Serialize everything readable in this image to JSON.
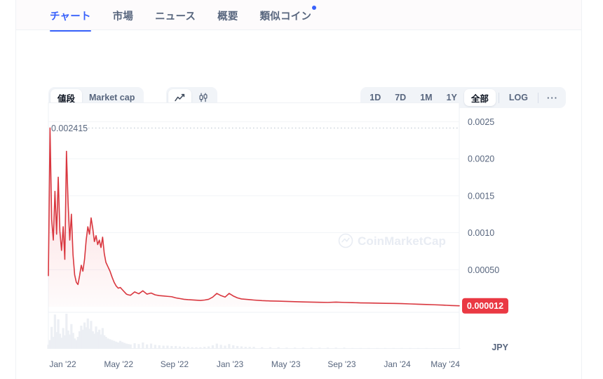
{
  "tabs": [
    {
      "label": "チャート",
      "active": true,
      "dot": false
    },
    {
      "label": "市場",
      "active": false,
      "dot": false
    },
    {
      "label": "ニュース",
      "active": false,
      "dot": false
    },
    {
      "label": "概要",
      "active": false,
      "dot": false
    },
    {
      "label": "類似コイン",
      "active": false,
      "dot": true
    }
  ],
  "toolbar": {
    "metric_price": "値段",
    "metric_marketcap": "Market cap",
    "chart_line_icon": "line-chart-icon",
    "chart_candle_icon": "candlestick-chart-icon",
    "ranges": [
      "1D",
      "7D",
      "1M",
      "1Y",
      "全部"
    ],
    "active_range": "全部",
    "log_label": "LOG",
    "more_label": "···"
  },
  "chart_data": {
    "type": "area",
    "title": "",
    "xlabel": "",
    "ylabel": "",
    "currency": "JPY",
    "watermark": "CoinMarketCap",
    "ylim": [
      0,
      0.00275
    ],
    "yticks": [
      0.0005,
      0.001,
      0.0015,
      0.002,
      0.0025
    ],
    "ytick_labels": [
      "0.00050",
      "0.0010",
      "0.0015",
      "0.0020",
      "0.0025"
    ],
    "grid": true,
    "legend": "none",
    "ath_value": 0.002415,
    "ath_label": "0.002415",
    "current_value": 1.2e-05,
    "current_label": "0.000012",
    "line_color": "#d9373f",
    "fill_top_color": "rgba(234,57,67,0.22)",
    "fill_bottom_color": "rgba(234,57,67,0.02)",
    "badge_color": "#ea3943",
    "xticks": [
      "Jan '22",
      "May '22",
      "Sep '22",
      "Jan '23",
      "May '23",
      "Sep '23",
      "Jan '24",
      "May '24"
    ],
    "xtick_positions": [
      0.035,
      0.171,
      0.307,
      0.442,
      0.578,
      0.714,
      0.849,
      0.966
    ],
    "x": [
      0.0,
      0.004,
      0.008,
      0.012,
      0.016,
      0.02,
      0.024,
      0.028,
      0.032,
      0.036,
      0.04,
      0.044,
      0.048,
      0.052,
      0.056,
      0.06,
      0.064,
      0.068,
      0.072,
      0.076,
      0.08,
      0.084,
      0.088,
      0.092,
      0.096,
      0.1,
      0.104,
      0.108,
      0.112,
      0.116,
      0.12,
      0.124,
      0.128,
      0.132,
      0.136,
      0.14,
      0.145,
      0.15,
      0.155,
      0.16,
      0.165,
      0.17,
      0.175,
      0.18,
      0.185,
      0.19,
      0.195,
      0.2,
      0.21,
      0.22,
      0.23,
      0.24,
      0.25,
      0.26,
      0.27,
      0.28,
      0.29,
      0.3,
      0.31,
      0.32,
      0.33,
      0.34,
      0.35,
      0.36,
      0.37,
      0.38,
      0.39,
      0.4,
      0.41,
      0.42,
      0.43,
      0.44,
      0.45,
      0.46,
      0.47,
      0.48,
      0.49,
      0.5,
      0.52,
      0.54,
      0.56,
      0.58,
      0.6,
      0.62,
      0.64,
      0.66,
      0.68,
      0.7,
      0.72,
      0.74,
      0.76,
      0.78,
      0.8,
      0.82,
      0.84,
      0.86,
      0.88,
      0.9,
      0.92,
      0.94,
      0.96,
      0.98,
      1.0
    ],
    "values": [
      0.00042,
      0.002415,
      0.00118,
      0.0009,
      0.00156,
      0.00098,
      0.00175,
      0.00102,
      0.00076,
      0.00108,
      0.00064,
      0.0021,
      0.0014,
      0.0009,
      0.00125,
      0.0007,
      0.00043,
      0.00033,
      0.0003,
      0.00042,
      0.00056,
      0.00048,
      0.00064,
      0.0009,
      0.00108,
      0.00098,
      0.0012,
      0.00106,
      0.00088,
      0.00096,
      0.00084,
      0.0009,
      0.0008,
      0.00094,
      0.00072,
      0.0006,
      0.00054,
      0.00048,
      0.0004,
      0.00033,
      0.00028,
      0.00025,
      0.00026,
      0.00023,
      0.0002,
      0.00017,
      0.00016,
      0.000155,
      0.0002,
      0.000175,
      0.000215,
      0.00017,
      0.000185,
      0.00016,
      0.00015,
      0.000145,
      0.00014,
      0.000135,
      0.00012,
      0.00011,
      0.0001,
      9.5e-05,
      9.2e-05,
      8.8e-05,
      8.5e-05,
      9e-05,
      0.0001,
      0.00013,
      0.00018,
      0.00015,
      0.00013,
      0.00018,
      0.000145,
      0.00012,
      0.000105,
      0.0001,
      9.5e-05,
      9e-05,
      8.2e-05,
      7.8e-05,
      7.5e-05,
      7.2e-05,
      6.8e-05,
      6.5e-05,
      6.2e-05,
      6e-05,
      5.8e-05,
      6.2e-05,
      5.8e-05,
      5.5e-05,
      5.2e-05,
      5e-05,
      4.8e-05,
      4.6e-05,
      4.4e-05,
      4.2e-05,
      3.8e-05,
      3.4e-05,
      3e-05,
      2.6e-05,
      2.2e-05,
      1.6e-05,
      1.2e-05
    ],
    "volume": [
      0.1,
      0.22,
      0.55,
      0.3,
      0.86,
      0.42,
      0.74,
      0.38,
      0.28,
      0.52,
      0.34,
      0.88,
      0.46,
      0.36,
      0.62,
      0.4,
      0.26,
      0.22,
      0.3,
      0.44,
      0.58,
      0.48,
      0.66,
      0.54,
      0.76,
      0.5,
      0.7,
      0.44,
      0.38,
      0.56,
      0.42,
      0.48,
      0.36,
      0.52,
      0.34,
      0.3,
      0.26,
      0.24,
      0.22,
      0.2,
      0.18,
      0.16,
      0.2,
      0.17,
      0.15,
      0.13,
      0.12,
      0.11,
      0.14,
      0.12,
      0.16,
      0.11,
      0.13,
      0.1,
      0.09,
      0.08,
      0.08,
      0.07,
      0.07,
      0.06,
      0.05,
      0.05,
      0.04,
      0.04,
      0.04,
      0.05,
      0.06,
      0.09,
      0.13,
      0.1,
      0.08,
      0.12,
      0.09,
      0.07,
      0.06,
      0.05,
      0.05,
      0.05,
      0.04,
      0.04,
      0.04,
      0.03,
      0.03,
      0.03,
      0.03,
      0.03,
      0.03,
      0.03,
      0.03,
      0.02,
      0.02,
      0.02,
      0.02,
      0.02,
      0.02,
      0.02,
      0.02,
      0.02,
      0.02,
      0.01,
      0.01,
      0.01,
      0.01
    ]
  }
}
